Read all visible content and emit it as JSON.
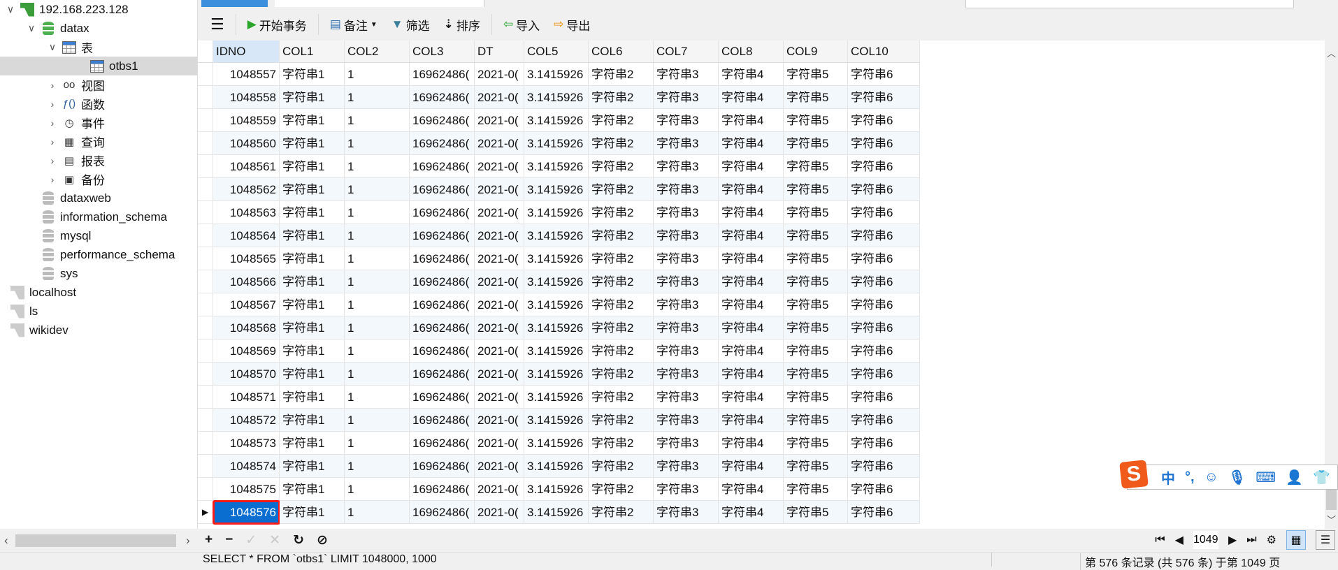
{
  "sidebar": {
    "items": [
      {
        "label": "192.168.223.128",
        "icon": "connection-icon",
        "level": 0,
        "expanded": true,
        "green": true
      },
      {
        "label": "datax",
        "icon": "database-icon",
        "level": 1,
        "expanded": true,
        "green": true
      },
      {
        "label": "表",
        "icon": "table-group-icon",
        "level": 2,
        "expanded": true
      },
      {
        "label": "otbs1",
        "icon": "table-icon",
        "level": 3,
        "selected": true
      },
      {
        "label": "视图",
        "icon": "view-icon",
        "level": 2,
        "expanded": false
      },
      {
        "label": "函数",
        "icon": "function-icon",
        "level": 2,
        "expanded": false
      },
      {
        "label": "事件",
        "icon": "event-icon",
        "level": 2,
        "expanded": false
      },
      {
        "label": "查询",
        "icon": "query-icon",
        "level": 2,
        "expanded": false
      },
      {
        "label": "报表",
        "icon": "report-icon",
        "level": 2,
        "expanded": false
      },
      {
        "label": "备份",
        "icon": "backup-icon",
        "level": 2,
        "expanded": false
      },
      {
        "label": "dataxweb",
        "icon": "database-icon",
        "level": 1
      },
      {
        "label": "information_schema",
        "icon": "database-icon",
        "level": 1
      },
      {
        "label": "mysql",
        "icon": "database-icon",
        "level": 1
      },
      {
        "label": "performance_schema",
        "icon": "database-icon",
        "level": 1
      },
      {
        "label": "sys",
        "icon": "database-icon",
        "level": 1
      },
      {
        "label": "localhost",
        "icon": "connection-icon",
        "level": 0
      },
      {
        "label": "ls",
        "icon": "connection-icon",
        "level": 0
      },
      {
        "label": "wikidev",
        "icon": "connection-icon",
        "level": 0
      }
    ]
  },
  "toolbar": {
    "menu_icon": "hamburger-icon",
    "begin_transaction": "开始事务",
    "note": "备注",
    "filter": "筛选",
    "sort": "排序",
    "import": "导入",
    "export": "导出"
  },
  "grid": {
    "columns": [
      "IDNO",
      "COL1",
      "COL2",
      "COL3",
      "DT",
      "COL5",
      "COL6",
      "COL7",
      "COL8",
      "COL9",
      "COL10"
    ],
    "rows": [
      [
        "1048557",
        "字符串1",
        "1",
        "16962486(",
        "2021-0(",
        "3.1415926",
        "字符串2",
        "字符串3",
        "字符串4",
        "字符串5",
        "字符串6"
      ],
      [
        "1048558",
        "字符串1",
        "1",
        "16962486(",
        "2021-0(",
        "3.1415926",
        "字符串2",
        "字符串3",
        "字符串4",
        "字符串5",
        "字符串6"
      ],
      [
        "1048559",
        "字符串1",
        "1",
        "16962486(",
        "2021-0(",
        "3.1415926",
        "字符串2",
        "字符串3",
        "字符串4",
        "字符串5",
        "字符串6"
      ],
      [
        "1048560",
        "字符串1",
        "1",
        "16962486(",
        "2021-0(",
        "3.1415926",
        "字符串2",
        "字符串3",
        "字符串4",
        "字符串5",
        "字符串6"
      ],
      [
        "1048561",
        "字符串1",
        "1",
        "16962486(",
        "2021-0(",
        "3.1415926",
        "字符串2",
        "字符串3",
        "字符串4",
        "字符串5",
        "字符串6"
      ],
      [
        "1048562",
        "字符串1",
        "1",
        "16962486(",
        "2021-0(",
        "3.1415926",
        "字符串2",
        "字符串3",
        "字符串4",
        "字符串5",
        "字符串6"
      ],
      [
        "1048563",
        "字符串1",
        "1",
        "16962486(",
        "2021-0(",
        "3.1415926",
        "字符串2",
        "字符串3",
        "字符串4",
        "字符串5",
        "字符串6"
      ],
      [
        "1048564",
        "字符串1",
        "1",
        "16962486(",
        "2021-0(",
        "3.1415926",
        "字符串2",
        "字符串3",
        "字符串4",
        "字符串5",
        "字符串6"
      ],
      [
        "1048565",
        "字符串1",
        "1",
        "16962486(",
        "2021-0(",
        "3.1415926",
        "字符串2",
        "字符串3",
        "字符串4",
        "字符串5",
        "字符串6"
      ],
      [
        "1048566",
        "字符串1",
        "1",
        "16962486(",
        "2021-0(",
        "3.1415926",
        "字符串2",
        "字符串3",
        "字符串4",
        "字符串5",
        "字符串6"
      ],
      [
        "1048567",
        "字符串1",
        "1",
        "16962486(",
        "2021-0(",
        "3.1415926",
        "字符串2",
        "字符串3",
        "字符串4",
        "字符串5",
        "字符串6"
      ],
      [
        "1048568",
        "字符串1",
        "1",
        "16962486(",
        "2021-0(",
        "3.1415926",
        "字符串2",
        "字符串3",
        "字符串4",
        "字符串5",
        "字符串6"
      ],
      [
        "1048569",
        "字符串1",
        "1",
        "16962486(",
        "2021-0(",
        "3.1415926",
        "字符串2",
        "字符串3",
        "字符串4",
        "字符串5",
        "字符串6"
      ],
      [
        "1048570",
        "字符串1",
        "1",
        "16962486(",
        "2021-0(",
        "3.1415926",
        "字符串2",
        "字符串3",
        "字符串4",
        "字符串5",
        "字符串6"
      ],
      [
        "1048571",
        "字符串1",
        "1",
        "16962486(",
        "2021-0(",
        "3.1415926",
        "字符串2",
        "字符串3",
        "字符串4",
        "字符串5",
        "字符串6"
      ],
      [
        "1048572",
        "字符串1",
        "1",
        "16962486(",
        "2021-0(",
        "3.1415926",
        "字符串2",
        "字符串3",
        "字符串4",
        "字符串5",
        "字符串6"
      ],
      [
        "1048573",
        "字符串1",
        "1",
        "16962486(",
        "2021-0(",
        "3.1415926",
        "字符串2",
        "字符串3",
        "字符串4",
        "字符串5",
        "字符串6"
      ],
      [
        "1048574",
        "字符串1",
        "1",
        "16962486(",
        "2021-0(",
        "3.1415926",
        "字符串2",
        "字符串3",
        "字符串4",
        "字符串5",
        "字符串6"
      ],
      [
        "1048575",
        "字符串1",
        "1",
        "16962486(",
        "2021-0(",
        "3.1415926",
        "字符串2",
        "字符串3",
        "字符串4",
        "字符串5",
        "字符串6"
      ],
      [
        "1048576",
        "字符串1",
        "1",
        "16962486(",
        "2021-0(",
        "3.1415926",
        "字符串2",
        "字符串3",
        "字符串4",
        "字符串5",
        "字符串6"
      ]
    ],
    "current_row": "1048576",
    "selection_color": "#0a6ed1",
    "highlight_border_color": "#ff1a1a"
  },
  "pager": {
    "page_value": "1049"
  },
  "ime": {
    "logo": "S",
    "mode": "中",
    "punct": "°,"
  },
  "status": {
    "sql": "SELECT * FROM `otbs1` LIMIT 1048000, 1000",
    "record": "第 576 条记录 (共 576 条) 于第 1049 页"
  }
}
